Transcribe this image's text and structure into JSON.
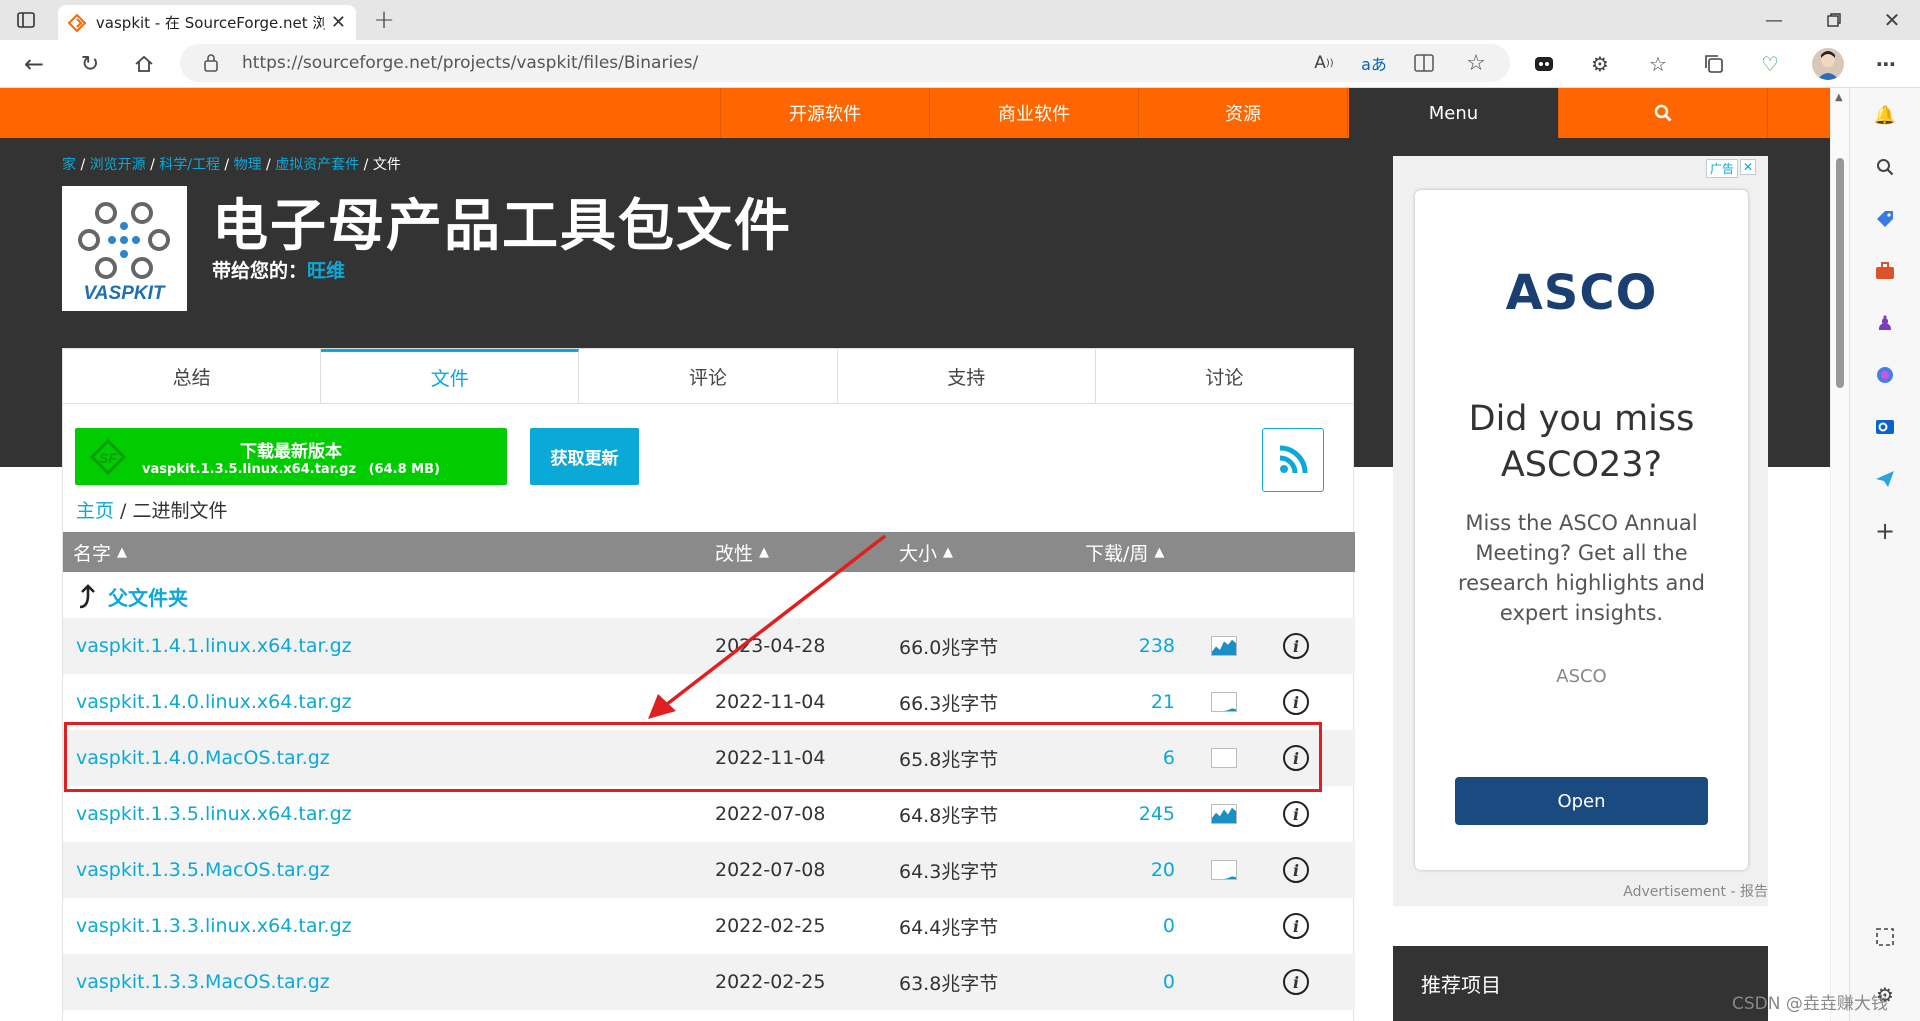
{
  "browser": {
    "tab_title": "vaspkit - 在 SourceForge.net 浏览",
    "url": "https://sourceforge.net/projects/vaspkit/files/Binaries/",
    "new_tab_icon": "plus-icon"
  },
  "site_nav": {
    "items": [
      "开源软件",
      "商业软件",
      "资源",
      "Menu"
    ],
    "search_icon": "search-icon",
    "brand_color": "#ff6600"
  },
  "breadcrumb": {
    "items": [
      "家",
      "浏览开源",
      "科学/工程",
      "物理",
      "虚拟资产套件"
    ],
    "current": "文件"
  },
  "project": {
    "logo_text": "VASPKIT",
    "title": "电子母产品工具包文件",
    "brought_label": "带给您的：",
    "brought_by": "旺维"
  },
  "project_tabs": [
    "总结",
    "文件",
    "评论",
    "支持",
    "讨论"
  ],
  "active_tab": 1,
  "download": {
    "title": "下载最新版本",
    "file": "vaspkit.1.3.5.linux.x64.tar.gz",
    "size": "(64.8 MB)",
    "updates_label": "获取更新"
  },
  "path": {
    "home": "主页",
    "current": "二进制文件"
  },
  "table": {
    "headers": {
      "name": "名字",
      "modified": "改性",
      "size": "大小",
      "downloads": "下载/周"
    },
    "parent_label": "父文件夹",
    "rows": [
      {
        "name": "vaspkit.1.4.1.linux.x64.tar.gz",
        "date": "2023-04-28",
        "size": "66.0兆字节",
        "downloads": "238",
        "spark": [
          0.2,
          0.5,
          0.3,
          0.8,
          0.6,
          0.9,
          0.7
        ]
      },
      {
        "name": "vaspkit.1.4.0.linux.x64.tar.gz",
        "date": "2022-11-04",
        "size": "66.3兆字节",
        "downloads": "21",
        "spark": [
          0.0,
          0.0,
          0.0,
          0.0,
          0.05,
          0.15,
          0.1
        ]
      },
      {
        "name": "vaspkit.1.4.0.MacOS.tar.gz",
        "date": "2022-11-04",
        "size": "65.8兆字节",
        "downloads": "6",
        "spark": [
          0,
          0,
          0,
          0,
          0,
          0,
          0
        ]
      },
      {
        "name": "vaspkit.1.3.5.linux.x64.tar.gz",
        "date": "2022-07-08",
        "size": "64.8兆字节",
        "downloads": "245",
        "spark": [
          0.3,
          0.6,
          0.4,
          0.8,
          0.5,
          0.9,
          0.7
        ]
      },
      {
        "name": "vaspkit.1.3.5.MacOS.tar.gz",
        "date": "2022-07-08",
        "size": "64.3兆字节",
        "downloads": "20",
        "spark": [
          0.0,
          0.0,
          0.0,
          0.0,
          0.05,
          0.15,
          0.1
        ]
      },
      {
        "name": "vaspkit.1.3.3.linux.x64.tar.gz",
        "date": "2022-02-25",
        "size": "64.4兆字节",
        "downloads": "0",
        "spark": null
      },
      {
        "name": "vaspkit.1.3.3.MacOS.tar.gz",
        "date": "2022-02-25",
        "size": "63.8兆字节",
        "downloads": "0",
        "spark": null
      }
    ]
  },
  "ad": {
    "badge": "广告",
    "brand": "ASCO",
    "headline_1": "Did you miss",
    "headline_2": "ASCO23?",
    "body": "Miss the ASCO Annual Meeting? Get all the research highlights and expert insights.",
    "source": "ASCO",
    "cta": "Open",
    "footer": "Advertisement - 报告"
  },
  "sidebar_section": "推荐项目",
  "watermark": "CSDN @垚垚赚大钱"
}
